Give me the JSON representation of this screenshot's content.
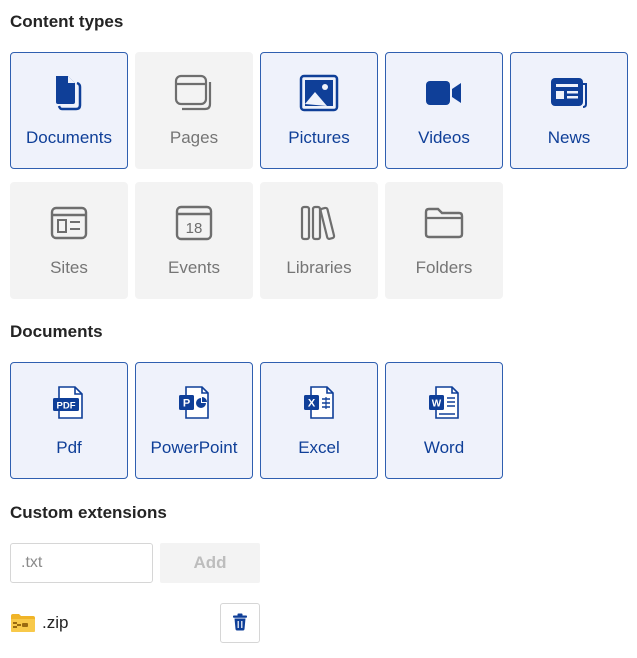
{
  "content_types": {
    "title": "Content types",
    "items": [
      {
        "label": "Documents",
        "icon": "document-icon",
        "selected": true
      },
      {
        "label": "Pages",
        "icon": "pages-icon",
        "selected": false
      },
      {
        "label": "Pictures",
        "icon": "picture-icon",
        "selected": true
      },
      {
        "label": "Videos",
        "icon": "video-camera-icon",
        "selected": true
      },
      {
        "label": "News",
        "icon": "news-icon",
        "selected": true
      },
      {
        "label": "Sites",
        "icon": "site-icon",
        "selected": false
      },
      {
        "label": "Events",
        "icon": "calendar-icon",
        "selected": false,
        "icon_text": "18"
      },
      {
        "label": "Libraries",
        "icon": "library-icon",
        "selected": false
      },
      {
        "label": "Folders",
        "icon": "folder-icon",
        "selected": false
      }
    ]
  },
  "documents": {
    "title": "Documents",
    "items": [
      {
        "label": "Pdf",
        "icon": "pdf-file-icon",
        "selected": true,
        "badge": "PDF"
      },
      {
        "label": "PowerPoint",
        "icon": "powerpoint-file-icon",
        "selected": true,
        "badge": "P"
      },
      {
        "label": "Excel",
        "icon": "excel-file-icon",
        "selected": true,
        "badge": "X"
      },
      {
        "label": "Word",
        "icon": "word-file-icon",
        "selected": true,
        "badge": "W"
      }
    ]
  },
  "custom_extensions": {
    "title": "Custom extensions",
    "input_placeholder": ".txt",
    "input_value": "",
    "add_label": "Add",
    "entries": [
      {
        "label": ".zip",
        "icon": "zip-folder-icon",
        "delete_icon": "trash-icon"
      }
    ]
  },
  "colors": {
    "selected_bg": "#eff2fb",
    "selected_border": "#2f5fb0",
    "selected_text": "#0f3f98",
    "unselected_bg": "#f3f3f3",
    "unselected_text": "#757575",
    "icon_blue": "#0f3f98",
    "icon_gray": "#6e6e6e",
    "zip_yellow": "#f0b428"
  }
}
